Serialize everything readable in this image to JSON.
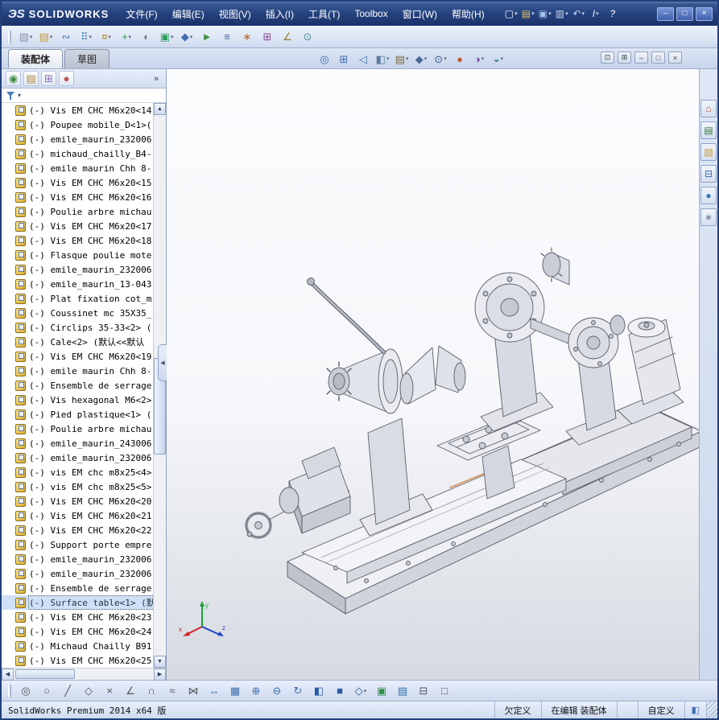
{
  "titlebar": {
    "brand_ds": "ЭS",
    "brand": "SOLIDWORKS",
    "menus": [
      {
        "label": "文件(F)"
      },
      {
        "label": "编辑(E)"
      },
      {
        "label": "视图(V)"
      },
      {
        "label": "插入(I)"
      },
      {
        "label": "工具(T)"
      },
      {
        "label": "Toolbox"
      },
      {
        "label": "窗口(W)"
      },
      {
        "label": "帮助(H)"
      }
    ],
    "quick_icons": [
      {
        "name": "new-document-icon",
        "glyph": "▢",
        "fg": "#f2f5fb",
        "caret": true
      },
      {
        "name": "open-icon",
        "glyph": "▤",
        "fg": "#e8c05a",
        "caret": true
      },
      {
        "name": "save-icon",
        "glyph": "▣",
        "fg": "#a8c4f0",
        "caret": true
      },
      {
        "name": "print-icon",
        "glyph": "▥",
        "fg": "#ccd6e8",
        "caret": true
      },
      {
        "name": "undo-icon",
        "glyph": "↶",
        "fg": "#bcd2f5",
        "caret": true
      },
      {
        "name": "selection-icon",
        "glyph": "I",
        "fg": "#eef2fa",
        "caret": true
      },
      {
        "name": "help-icon",
        "glyph": "?",
        "fg": "#ffffff"
      }
    ],
    "window_buttons": [
      {
        "name": "minimize-button",
        "glyph": "–"
      },
      {
        "name": "maximize-button",
        "glyph": "□"
      },
      {
        "name": "close-button",
        "glyph": "×"
      }
    ]
  },
  "main_toolbar": {
    "icons": [
      {
        "name": "insert-components-icon",
        "glyph": "▧",
        "fg": "#8894ab",
        "caret": true
      },
      {
        "name": "open-part-icon",
        "glyph": "▤",
        "fg": "#c89a3a",
        "caret": true
      },
      {
        "name": "mate-icon",
        "glyph": "∾",
        "fg": "#5a7ab0"
      },
      {
        "name": "component-pattern-icon",
        "glyph": "⠿",
        "fg": "#2f7fbf",
        "caret": true
      },
      {
        "name": "smart-fasteners-icon",
        "glyph": "¤",
        "fg": "#b0892f",
        "caret": true
      },
      {
        "name": "move-component-icon",
        "glyph": "+",
        "fg": "#3f8f4f",
        "caret": true
      },
      {
        "name": "show-hidden-components-icon",
        "glyph": "◐",
        "fg": "#707a8a"
      },
      {
        "name": "assembly-features-icon",
        "glyph": "▣",
        "fg": "#2f9f5f",
        "caret": true
      },
      {
        "name": "reference-geometry-icon",
        "glyph": "◆",
        "fg": "#3f6fae",
        "caret": true
      },
      {
        "name": "new-motion-study-icon",
        "glyph": "►",
        "fg": "#3f8f3f"
      },
      {
        "name": "bill-of-materials-icon",
        "glyph": "≡",
        "fg": "#4a6a9a"
      },
      {
        "name": "exploded-view-icon",
        "glyph": "∗",
        "fg": "#b06a2a"
      },
      {
        "name": "interference-detection-icon",
        "glyph": "⊞",
        "fg": "#8a4a9a"
      },
      {
        "name": "measure-icon",
        "glyph": "∠",
        "fg": "#9a7a2a"
      },
      {
        "name": "mass-properties-icon",
        "glyph": "⊙",
        "fg": "#4a8a8a"
      }
    ]
  },
  "tabs": [
    {
      "label": "装配体",
      "active": true,
      "name": "tab-assembly"
    },
    {
      "label": "草图",
      "name": "tab-sketch"
    }
  ],
  "headsup": {
    "icons": [
      {
        "name": "zoom-fit-icon",
        "glyph": "◎",
        "fg": "#3f6fae"
      },
      {
        "name": "zoom-area-icon",
        "glyph": "⊞",
        "fg": "#3f6fae"
      },
      {
        "name": "previous-view-icon",
        "glyph": "◁",
        "fg": "#3f6fae"
      },
      {
        "name": "section-view-icon",
        "glyph": "◧",
        "fg": "#5a7a9a",
        "caret": true
      },
      {
        "name": "view-orientation-icon",
        "glyph": "▤",
        "fg": "#7a6a3a",
        "caret": true
      },
      {
        "name": "display-style-icon",
        "glyph": "◆",
        "fg": "#4a6a9a",
        "caret": true
      },
      {
        "name": "hide-show-items-icon",
        "glyph": "⊙",
        "fg": "#3a5a8a",
        "caret": true
      },
      {
        "name": "edit-appearance-icon",
        "glyph": "●",
        "fg": "#c06030"
      },
      {
        "name": "apply-scene-icon",
        "glyph": "◑",
        "fg": "#7a4a9a",
        "caret": true
      },
      {
        "name": "view-settings-icon",
        "glyph": "◒",
        "fg": "#4a8a8a",
        "caret": true
      }
    ]
  },
  "doc_controls": [
    {
      "name": "pane-layout-icon",
      "glyph": "⊡"
    },
    {
      "name": "split-view-icon",
      "glyph": "⊞"
    },
    {
      "name": "doc-minimize-button",
      "glyph": "–"
    },
    {
      "name": "doc-restore-button",
      "glyph": "□"
    },
    {
      "name": "doc-close-button",
      "glyph": "×"
    }
  ],
  "panel": {
    "manager_tabs": [
      {
        "name": "featuremanager-tab-icon",
        "glyph": "◉",
        "fg": "#3f8f3f"
      },
      {
        "name": "propertymanager-tab-icon",
        "glyph": "▤",
        "fg": "#b08a3a"
      },
      {
        "name": "configurationmanager-tab-icon",
        "glyph": "⊞",
        "fg": "#8a6ab0"
      },
      {
        "name": "dimxpertmanager-tab-icon",
        "glyph": "●",
        "fg": "#c05050"
      }
    ],
    "expand_chevron": "»",
    "splitter_glyph": "◀",
    "tree_items": [
      {
        "label": "(-) Vis EM CHC M6x20<14"
      },
      {
        "label": "(-) Poupee mobile_D<1>("
      },
      {
        "label": "(-) emile_maurin_232006"
      },
      {
        "label": "(-) michaud_chailly_B4-"
      },
      {
        "label": "(-) emile maurin Chh 8-"
      },
      {
        "label": "(-) Vis EM CHC M6x20<15"
      },
      {
        "label": "(-) Vis EM CHC M6x20<16"
      },
      {
        "label": "(-) Poulie arbre michau"
      },
      {
        "label": "(-) Vis EM CHC M6x20<17"
      },
      {
        "label": "(-) Vis EM CHC M6x20<18"
      },
      {
        "label": "(-) Flasque poulie mote"
      },
      {
        "label": "(-) emile_maurin_232006"
      },
      {
        "label": "(-) emile_maurin_13-043"
      },
      {
        "label": "(-) Plat fixation cot_m"
      },
      {
        "label": "(-) Coussinet mc 35X35_"
      },
      {
        "label": "(-) Circlips 35-33<2> ("
      },
      {
        "label": "(-) Cale<2> (默认<<默认"
      },
      {
        "label": "(-) Vis EM CHC M6x20<19"
      },
      {
        "label": "(-) emile maurin Chh 8-"
      },
      {
        "label": "(-) Ensemble de serrage"
      },
      {
        "label": "(-) Vis hexagonal M6<2>"
      },
      {
        "label": "(-) Pied plastique<1> ("
      },
      {
        "label": "(-) Poulie arbre michau"
      },
      {
        "label": "(-) emile_maurin_243006"
      },
      {
        "label": "(-) emile_maurin_232006"
      },
      {
        "label": "(-) vis EM chc m8x25<4>"
      },
      {
        "label": "(-) vis EM chc m8x25<5>"
      },
      {
        "label": "(-) Vis EM CHC M6x20<20"
      },
      {
        "label": "(-) Vis EM CHC M6x20<21"
      },
      {
        "label": "(-) Vis EM CHC M6x20<22"
      },
      {
        "label": "(-) Support porte empre"
      },
      {
        "label": "(-) emile_maurin_232006"
      },
      {
        "label": "(-) emile_maurin_232006"
      },
      {
        "label": "(-) Ensemble de serrage"
      },
      {
        "label": "(-) Surface table<1> (默",
        "selected": true
      },
      {
        "label": "(-) Vis EM CHC M6x20<23"
      },
      {
        "label": "(-) Vis EM CHC M6x20<24"
      },
      {
        "label": "(-) Michaud Chailly B91"
      },
      {
        "label": "(-) Vis EM CHC M6x20<25"
      }
    ]
  },
  "taskpane": {
    "icons": [
      {
        "name": "home-icon",
        "glyph": "⌂",
        "fg": "#b05a2a"
      },
      {
        "name": "design-library-icon",
        "glyph": "▤",
        "fg": "#3a7a3a"
      },
      {
        "name": "file-explorer-icon",
        "glyph": "▧",
        "fg": "#c8973a"
      },
      {
        "name": "view-palette-icon",
        "glyph": "⊟",
        "fg": "#3f6fae"
      },
      {
        "name": "appearances-icon",
        "glyph": "●",
        "fg": "#2a7ab0"
      },
      {
        "name": "custom-properties-icon",
        "glyph": "∗",
        "fg": "#6a7a8a"
      }
    ]
  },
  "bottom_toolbar": {
    "icons": [
      {
        "name": "sketch-origin-icon",
        "glyph": "◎",
        "fg": "#555555"
      },
      {
        "name": "circle-tool-icon",
        "glyph": "○",
        "fg": "#555555"
      },
      {
        "name": "line-tool-icon",
        "glyph": "╱",
        "fg": "#555555"
      },
      {
        "name": "polygon-tool-icon",
        "glyph": "◇",
        "fg": "#555555"
      },
      {
        "name": "trim-tool-icon",
        "glyph": "×",
        "fg": "#555555"
      },
      {
        "name": "angle-dimension-icon",
        "glyph": "∠",
        "fg": "#555555"
      },
      {
        "name": "arc-tool-icon",
        "glyph": "∩",
        "fg": "#555555"
      },
      {
        "name": "spline-tool-icon",
        "glyph": "≈",
        "fg": "#555555"
      },
      {
        "name": "mirror-tool-icon",
        "glyph": "⋈",
        "fg": "#555555"
      },
      {
        "name": "pan-icon",
        "glyph": "↔",
        "fg": "#3f6fae"
      },
      {
        "name": "grid-icon",
        "glyph": "▦",
        "fg": "#3f6fae"
      },
      {
        "name": "zoom-in-icon",
        "glyph": "⊕",
        "fg": "#3f6fae"
      },
      {
        "name": "zoom-out-icon",
        "glyph": "⊖",
        "fg": "#3f6fae"
      },
      {
        "name": "rotate-view-icon",
        "glyph": "↻",
        "fg": "#3f6fae"
      },
      {
        "name": "shaded-view-icon",
        "glyph": "◧",
        "fg": "#2c5aa0"
      },
      {
        "name": "shaded-edges-view-icon",
        "glyph": "■",
        "fg": "#2c5aa0"
      },
      {
        "name": "wireframe-view-icon",
        "glyph": "◇",
        "fg": "#2c5aa0",
        "caret": true
      },
      {
        "name": "assembly-visualization-icon",
        "glyph": "▣",
        "fg": "#2f8f4f"
      },
      {
        "name": "assembly-xpert-icon",
        "glyph": "▤",
        "fg": "#2f6fae"
      },
      {
        "name": "camera-view-icon",
        "glyph": "⊟",
        "fg": "#555566"
      },
      {
        "name": "full-screen-icon",
        "glyph": "□",
        "fg": "#555566"
      }
    ]
  },
  "statusbar": {
    "product": "SolidWorks Premium 2014 x64 版",
    "define_state": "欠定义",
    "editing": "在编辑 装配体",
    "custom": "自定义",
    "display_glyph": "◧"
  },
  "triad": {
    "x": "x",
    "y": "y",
    "z": "z"
  }
}
